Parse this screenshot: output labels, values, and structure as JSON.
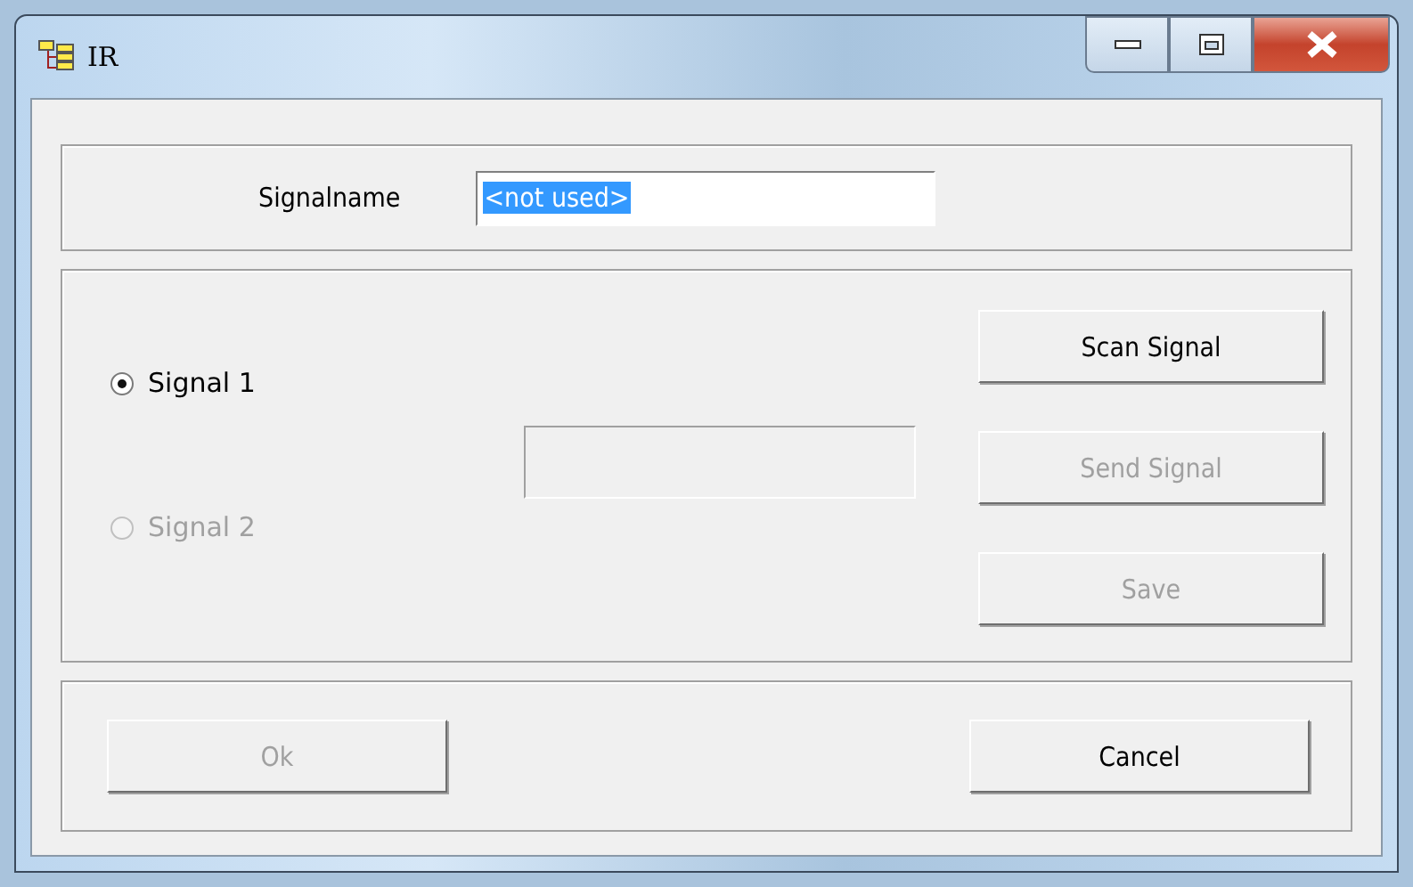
{
  "window": {
    "title": "IR"
  },
  "signalname": {
    "label": "Signalname",
    "value": "<not used>",
    "text_selected": true
  },
  "signals": [
    {
      "label": "Signal 1",
      "selected": true,
      "disabled": false
    },
    {
      "label": "Signal 2",
      "selected": false,
      "disabled": true
    }
  ],
  "signal_field": {
    "disabled": true
  },
  "actions": [
    {
      "label": "Scan Signal",
      "disabled": false
    },
    {
      "label": "Send Signal",
      "disabled": true
    },
    {
      "label": "Save",
      "disabled": true
    }
  ],
  "footer": [
    {
      "label": "Ok",
      "disabled": true
    },
    {
      "label": "Cancel",
      "disabled": false
    }
  ]
}
